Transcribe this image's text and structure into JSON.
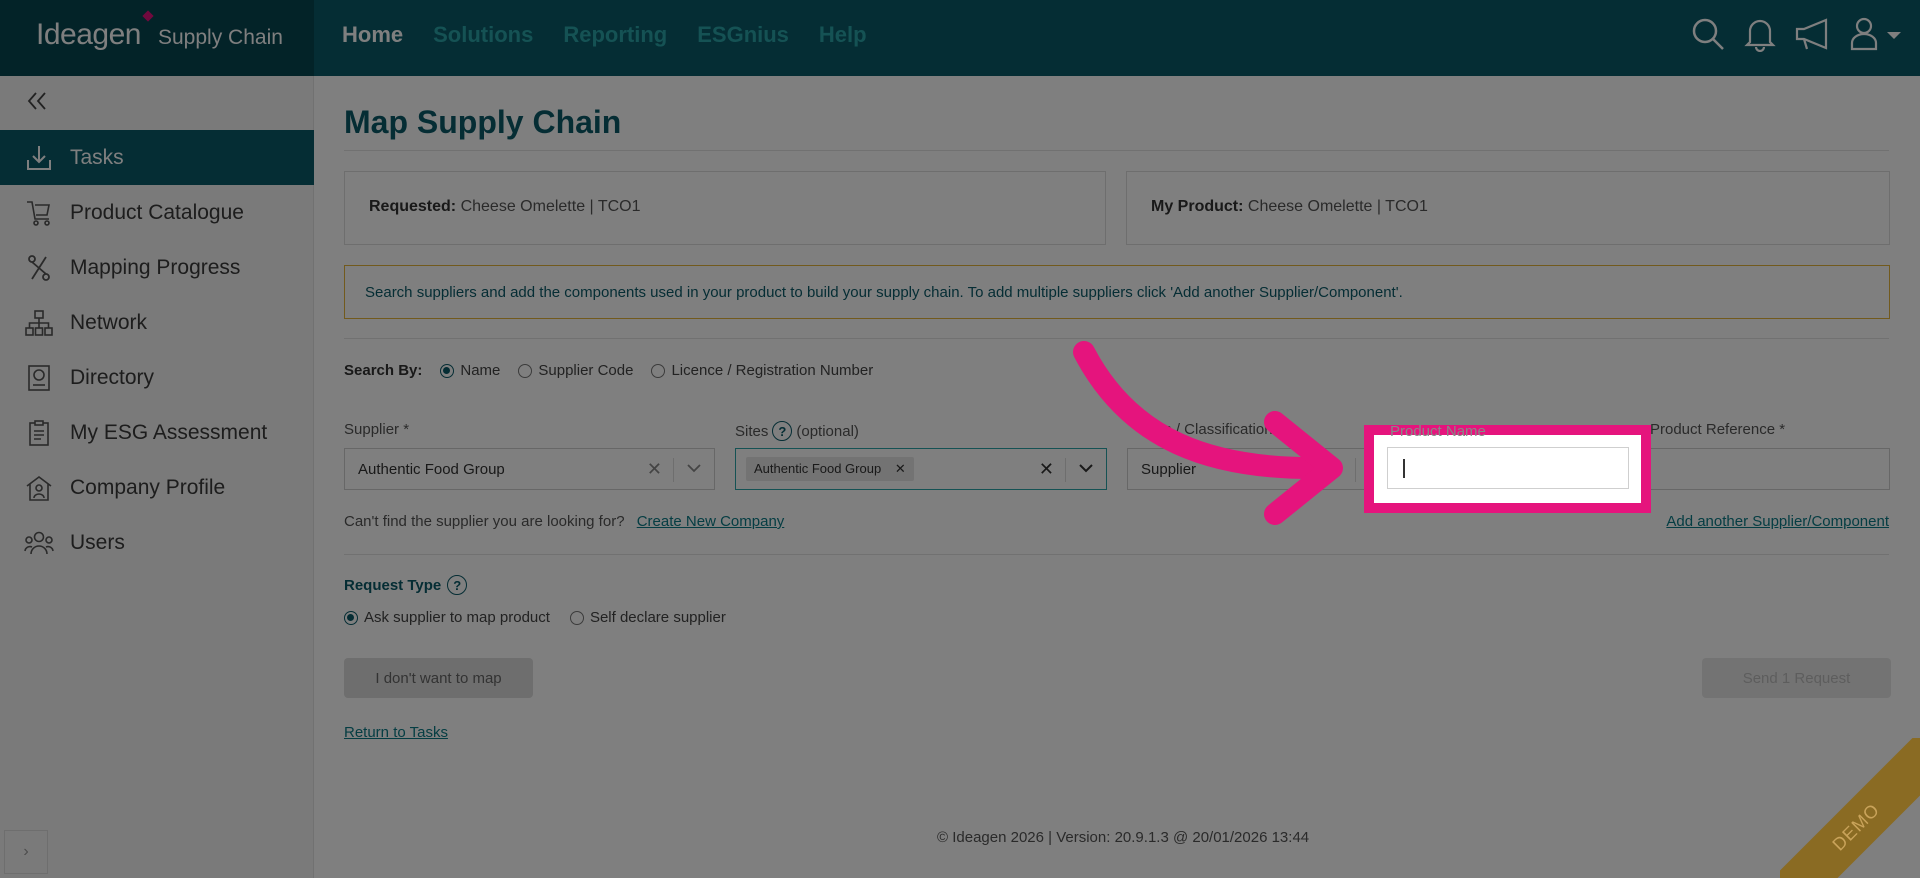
{
  "app": {
    "logo_text": "Ideagen",
    "product_name": "Supply Chain"
  },
  "nav": [
    "Home",
    "Solutions",
    "Reporting",
    "ESGnius",
    "Help"
  ],
  "sidebar": {
    "items": [
      {
        "label": "Tasks",
        "icon": "download-tray-icon"
      },
      {
        "label": "Product Catalogue",
        "icon": "trolley-icon"
      },
      {
        "label": "Mapping Progress",
        "icon": "route-icon"
      },
      {
        "label": "Network",
        "icon": "network-icon"
      },
      {
        "label": "Directory",
        "icon": "directory-icon"
      },
      {
        "label": "My ESG Assessment",
        "icon": "clipboard-icon"
      },
      {
        "label": "Company Profile",
        "icon": "building-icon"
      },
      {
        "label": "Users",
        "icon": "users-icon"
      }
    ]
  },
  "page": {
    "title": "Map Supply Chain",
    "requested_label": "Requested:",
    "requested_value": "Cheese Omelette | TCO1",
    "my_product_label": "My Product:",
    "my_product_value": "Cheese Omelette | TCO1",
    "notice": "Search suppliers and add the components used in your product to build your supply chain. To add multiple suppliers click 'Add another Supplier/Component'."
  },
  "search_by": {
    "label": "Search By:",
    "options": [
      "Name",
      "Supplier Code",
      "Licence / Registration Number"
    ],
    "selected": "Name"
  },
  "fields": {
    "supplier_label": "Supplier *",
    "supplier_value": "Authentic Food Group",
    "sites_label": "Sites",
    "sites_optional": "(optional)",
    "sites_tag": "Authentic Food Group",
    "classification_label": "ction / Classification",
    "classification_value": "Supplier",
    "product_name_label": "Product Name",
    "product_name_value": "",
    "product_reference_label": "Product Reference *"
  },
  "links": {
    "cant_find": "Can't find the supplier you are looking for?",
    "create_company": "Create New Company",
    "add_another": "Add another Supplier/Component",
    "return": "Return to Tasks"
  },
  "request_type": {
    "label": "Request Type",
    "options": [
      "Ask supplier to map product",
      "Self declare supplier"
    ],
    "selected": "Ask supplier to map product"
  },
  "buttons": {
    "no_map": "I don't want to map",
    "send": "Send 1 Request"
  },
  "footer": "© Ideagen 2026 | Version: 20.9.1.3 @ 20/01/2026 13:44",
  "demo_ribbon": "DEMO",
  "colors": {
    "brand_dark": "#064651",
    "brand": "#0b5b69",
    "accent_nav": "#2aa5a8",
    "highlight": "#e5147d",
    "notice_border": "#e4b43a"
  }
}
